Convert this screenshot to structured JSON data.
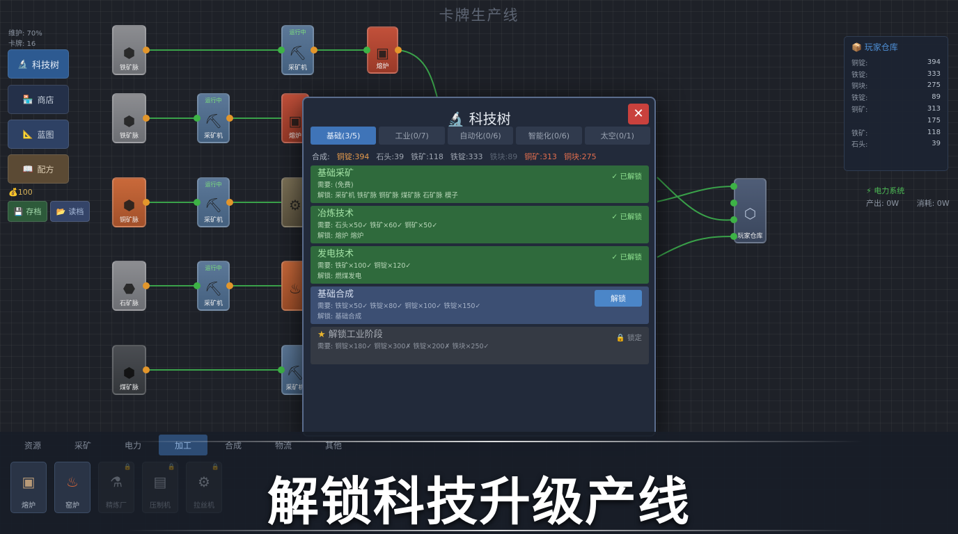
{
  "game": {
    "title": "卡牌生产线"
  },
  "left_panel": {
    "stat1": "维护: 70%",
    "stat2": "卡牌: 16",
    "tech_tree_label": "科技树",
    "shop_label": "商店",
    "blueprint_label": "蓝图",
    "recipe_label": "配方",
    "coins": "100",
    "save_label": "存档",
    "load_label": "读档"
  },
  "machines": {
    "r1c1": "铁矿脉",
    "r1c2": "采矿机",
    "r1c2_top": "运行中",
    "r1c3": "熔炉",
    "r2c1": "铁矿脉",
    "r2c2": "采矿机",
    "r2c2_top": "运行中",
    "r2c3": "熔炉",
    "r3c1": "铜矿脉",
    "r3c2": "采矿机",
    "r3c2_top": "运行中",
    "r3c3": "",
    "r4c1": "石矿脉",
    "r4c2": "采矿机",
    "r4c2_top": "运行中",
    "r4c3": "",
    "r5c1": "煤矿脉",
    "r5c2": "采矿机",
    "right": "玩家仓库"
  },
  "warehouse": {
    "title": "玩家仓库",
    "items": [
      {
        "name": "铜锭:",
        "value": "394"
      },
      {
        "name": "铁锭:",
        "value": "333"
      },
      {
        "name": "铜块:",
        "value": "275"
      },
      {
        "name": "铁锭:",
        "value": "89"
      },
      {
        "name": "铜矿:",
        "value": "313"
      },
      {
        "name": "",
        "value": "175"
      },
      {
        "name": "铁矿:",
        "value": "118"
      },
      {
        "name": "石头:",
        "value": "39"
      }
    ]
  },
  "power": {
    "title": "电力系统",
    "production": "产出: 0W",
    "consumption": "消耗: 0W"
  },
  "modal": {
    "title": "科技树",
    "close": "✕",
    "tabs": [
      "基础(3/5)",
      "工业(0/7)",
      "自动化(0/6)",
      "智能化(0/6)",
      "太空(0/1)"
    ],
    "resources": {
      "label": "合成:",
      "items": [
        "铜锭:394",
        "石头:39",
        "铁矿:118",
        "铁锭:333",
        "铁块:89",
        "铜矿:313",
        "铜块:275"
      ]
    },
    "techs": [
      {
        "name": "基础采矿",
        "line1": "需要: (免费)",
        "line2": "解锁: 采矿机 铁矿脉 铜矿脉 煤矿脉 石矿脉 模子",
        "status": "✓ 已解锁"
      },
      {
        "name": "冶炼技术",
        "line1": "需要: 石头×50✓ 铁矿×60✓ 铜矿×50✓",
        "line2": "解锁: 熔炉 熔炉",
        "status": "✓ 已解锁"
      },
      {
        "name": "发电技术",
        "line1": "需要: 铁矿×100✓ 铜锭×120✓",
        "line2": "解锁: 燃煤发电",
        "status": "✓ 已解锁"
      },
      {
        "name": "基础合成",
        "line1": "需要: 铁锭×50✓ 铁锭×80✓ 铜锭×100✓ 铁锭×150✓",
        "line2": "解锁: 基础合成",
        "button": "解锁"
      },
      {
        "name": "解锁工业阶段",
        "line1": "需要: 铜锭×180✓ 铜锭×300✗ 铁锭×200✗ 铁块×250✓",
        "status": "锁定"
      }
    ]
  },
  "bottom": {
    "tabs": [
      "资源",
      "采矿",
      "电力",
      "加工",
      "合成",
      "物流",
      "其他"
    ],
    "buildings": [
      {
        "label": "熔炉",
        "locked": false
      },
      {
        "label": "窑炉",
        "locked": false
      },
      {
        "label": "精炼厂",
        "locked": true
      },
      {
        "label": "压制机",
        "locked": true
      },
      {
        "label": "拉丝机",
        "locked": true
      }
    ]
  },
  "caption": "解锁科技升级产线",
  "colors": {
    "accent": "#3f74b8",
    "unlocked": "#2f6a3c",
    "close": "#c9413d",
    "wire": "#3a9a45"
  }
}
